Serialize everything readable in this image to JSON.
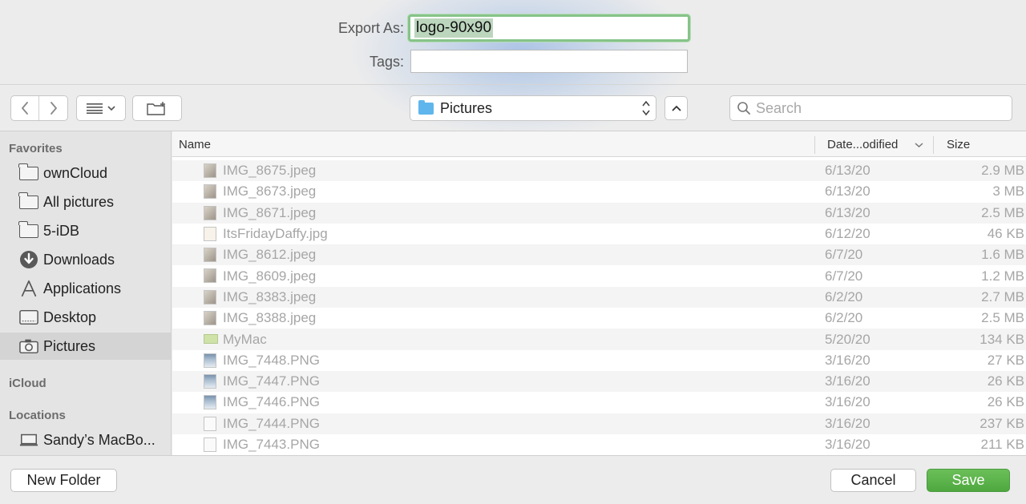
{
  "export": {
    "export_as_label": "Export As:",
    "export_as_value": "logo-90x90",
    "tags_label": "Tags:",
    "tags_value": ""
  },
  "toolbar": {
    "location": "Pictures",
    "search_placeholder": "Search"
  },
  "sidebar": {
    "favorites_title": "Favorites",
    "favorites": [
      {
        "label": "ownCloud",
        "icon": "folder-icon"
      },
      {
        "label": "All pictures",
        "icon": "folder-icon"
      },
      {
        "label": "5-iDB",
        "icon": "folder-icon"
      },
      {
        "label": "Downloads",
        "icon": "downloads-icon"
      },
      {
        "label": "Applications",
        "icon": "applications-icon"
      },
      {
        "label": "Desktop",
        "icon": "desktop-icon"
      },
      {
        "label": "Pictures",
        "icon": "camera-icon",
        "selected": true
      }
    ],
    "icloud_title": "iCloud",
    "locations_title": "Locations",
    "locations": [
      {
        "label": "Sandy’s MacBo...",
        "icon": "laptop-icon"
      }
    ]
  },
  "list": {
    "columns": [
      "Name",
      "Date...odified",
      "Size"
    ],
    "rows": [
      {
        "name": "IMG_8675.jpeg",
        "date": "6/13/20",
        "size": "2.9 MB",
        "thumb": "photo"
      },
      {
        "name": "IMG_8673.jpeg",
        "date": "6/13/20",
        "size": "3 MB",
        "thumb": "photo"
      },
      {
        "name": "IMG_8671.jpeg",
        "date": "6/13/20",
        "size": "2.5 MB",
        "thumb": "photo"
      },
      {
        "name": "ItsFridayDaffy.jpg",
        "date": "6/12/20",
        "size": "46 KB",
        "thumb": "daffy"
      },
      {
        "name": "IMG_8612.jpeg",
        "date": "6/7/20",
        "size": "1.6 MB",
        "thumb": "photo"
      },
      {
        "name": "IMG_8609.jpeg",
        "date": "6/7/20",
        "size": "1.2 MB",
        "thumb": "photo"
      },
      {
        "name": "IMG_8383.jpeg",
        "date": "6/2/20",
        "size": "2.7 MB",
        "thumb": "photo"
      },
      {
        "name": "IMG_8388.jpeg",
        "date": "6/2/20",
        "size": "2.5 MB",
        "thumb": "photo"
      },
      {
        "name": "MyMac",
        "date": "5/20/20",
        "size": "134 KB",
        "thumb": "green"
      },
      {
        "name": "IMG_7448.PNG",
        "date": "3/16/20",
        "size": "27 KB",
        "thumb": "png"
      },
      {
        "name": "IMG_7447.PNG",
        "date": "3/16/20",
        "size": "26 KB",
        "thumb": "png"
      },
      {
        "name": "IMG_7446.PNG",
        "date": "3/16/20",
        "size": "26 KB",
        "thumb": "png"
      },
      {
        "name": "IMG_7444.PNG",
        "date": "3/16/20",
        "size": "237 KB",
        "thumb": "blank"
      },
      {
        "name": "IMG_7443.PNG",
        "date": "3/16/20",
        "size": "211 KB",
        "thumb": "blank"
      }
    ]
  },
  "buttons": {
    "new_folder": "New Folder",
    "cancel": "Cancel",
    "save": "Save"
  },
  "colors": {
    "accent_green": "#5cb34b",
    "focus_ring": "#86c489",
    "location_folder": "#5fb6ec"
  }
}
